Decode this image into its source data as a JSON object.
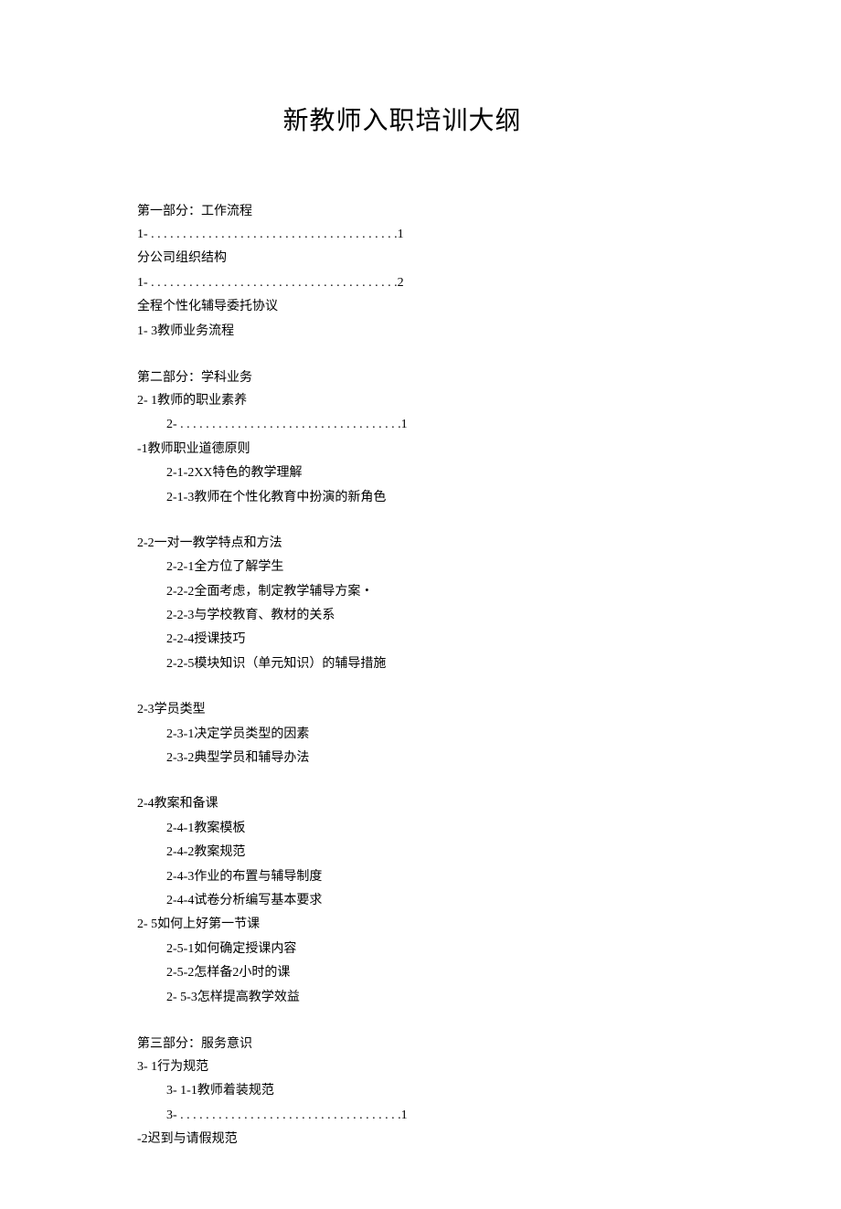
{
  "title": "新教师入职培训大纲",
  "part1": {
    "heading": "第一部分：工作流程",
    "items": {
      "l1a": "1- . . . . . . . . . . . . . . . . . . . . . . . . . . . . . . . . . . . . . . .1",
      "l1b": "分公司组织结构",
      "l2a": "1- . . . . . . . . . . . . . . . . . . . . . . . . . . . . . . . . . . . . . . .2",
      "l2b": "全程个性化辅导委托协议",
      "l3": "1-  3教师业务流程"
    }
  },
  "part2": {
    "heading": "第二部分：学科业务",
    "s21": {
      "head": "2-  1教师的职业素养",
      "l1a": "2- . . . . . . . . . . . . . . . . . . . . . . . . . . . . . . . . . . .1",
      "l1b": "-1教师职业道德原则",
      "l2": "2-1-2XX特色的教学理解",
      "l3": "2-1-3教师在个性化教育中扮演的新角色"
    },
    "s22": {
      "head": "2-2一对一教学特点和方法",
      "l1": "2-2-1全方位了解学生",
      "l2": "2-2-2全面考虑，制定教学辅导方案・",
      "l3": "2-2-3与学校教育、教材的关系",
      "l4": "2-2-4授课技巧",
      "l5": "2-2-5模块知识（单元知识）的辅导措施"
    },
    "s23": {
      "head": "2-3学员类型",
      "l1": "2-3-1决定学员类型的因素",
      "l2": "2-3-2典型学员和辅导办法"
    },
    "s24": {
      "head": "2-4教案和备课",
      "l1": "2-4-1教案模板",
      "l2": "2-4-2教案规范",
      "l3": "2-4-3作业的布置与辅导制度",
      "l4": "2-4-4试卷分析编写基本要求"
    },
    "s25": {
      "head": "2-  5如何上好第一节课",
      "l1": "2-5-1如何确定授课内容",
      "l2": "2-5-2怎样备2小时的课",
      "l3": "2-  5-3怎样提高教学效益"
    }
  },
  "part3": {
    "heading": "第三部分：服务意识",
    "s31": {
      "head": "3-  1行为规范",
      "l1": "3-  1-1教师着装规范",
      "l2a": "3- . . . . . . . . . . . . . . . . . . . . . . . . . . . . . . . . . . .1",
      "l2b": "-2迟到与请假规范"
    }
  }
}
